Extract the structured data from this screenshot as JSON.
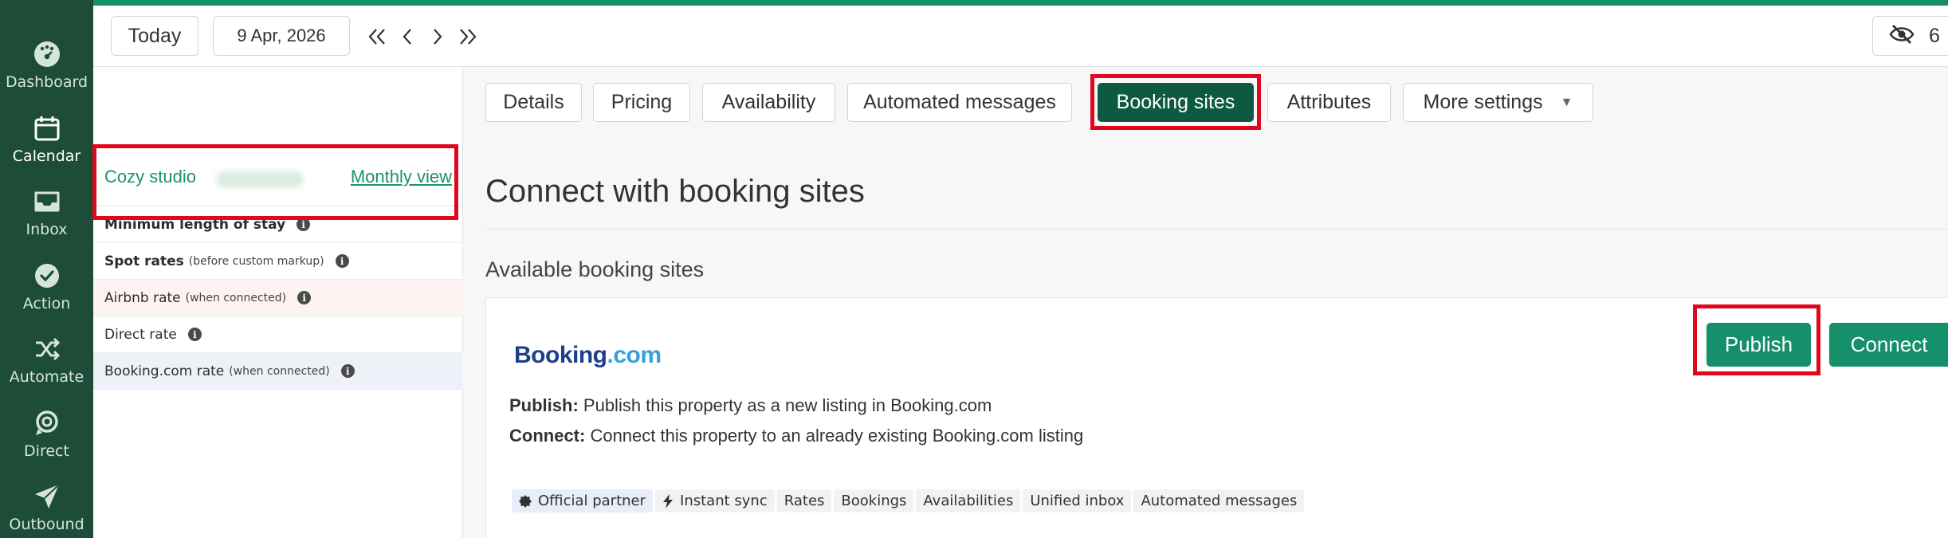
{
  "sidebar": {
    "items": [
      {
        "label": "Dashboard",
        "icon": "dashboard-gauge-icon"
      },
      {
        "label": "Calendar",
        "icon": "calendar-icon",
        "active": true
      },
      {
        "label": "Inbox",
        "icon": "inbox-tray-icon"
      },
      {
        "label": "Action",
        "icon": "check-circle-icon"
      },
      {
        "label": "Automate",
        "icon": "shuffle-icon"
      },
      {
        "label": "Direct",
        "icon": "direct-swirl-icon"
      },
      {
        "label": "Outbound",
        "icon": "paper-plane-icon"
      }
    ]
  },
  "topbar": {
    "today_label": "Today",
    "date_value": "9 Apr, 2026",
    "hidden_count": "6"
  },
  "listing": {
    "name": "Cozy studio",
    "monthly_view_label": "Monthly view"
  },
  "rate_rows": [
    {
      "label": "Minimum length of stay",
      "sub": ""
    },
    {
      "label": "Spot rates",
      "sub": "(before custom markup)"
    },
    {
      "label": "Airbnb rate",
      "sub": "(when connected)"
    },
    {
      "label": "Direct rate",
      "sub": ""
    },
    {
      "label": "Booking.com rate",
      "sub": "(when connected)"
    }
  ],
  "tabs": [
    {
      "label": "Details"
    },
    {
      "label": "Pricing"
    },
    {
      "label": "Availability"
    },
    {
      "label": "Automated messages"
    },
    {
      "label": "Booking sites",
      "active": true
    },
    {
      "label": "Attributes"
    },
    {
      "label": "More settings"
    }
  ],
  "main": {
    "page_title": "Connect with booking sites",
    "section_title": "Available booking sites"
  },
  "booking_card": {
    "logo_part1": "Booking",
    "logo_part2": ".com",
    "publish_title": "Publish:",
    "publish_desc": "Publish this property as a new listing in Booking.com",
    "connect_title": "Connect:",
    "connect_desc": "Connect this property to an already existing Booking.com listing",
    "publish_button": "Publish",
    "connect_button": "Connect",
    "tags": [
      "Official partner",
      "Instant sync",
      "Rates",
      "Bookings",
      "Availabilities",
      "Unified inbox",
      "Automated messages"
    ]
  },
  "colors": {
    "sidebar_bg": "#1d4d38",
    "accent_green": "#16906a",
    "active_tab": "#0d5a41",
    "link_green": "#1a9466",
    "highlight_red": "#e0061b"
  }
}
